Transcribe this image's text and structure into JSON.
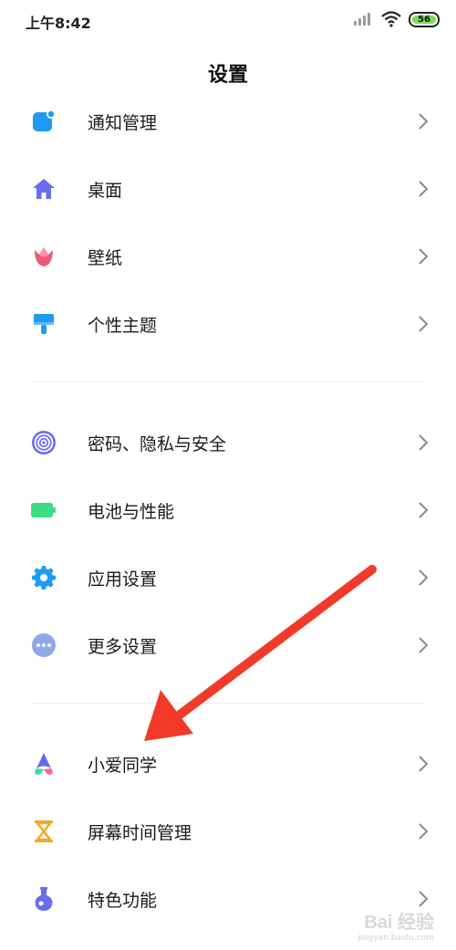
{
  "status_bar": {
    "time": "上午8:42",
    "battery": "56"
  },
  "header": {
    "title": "设置"
  },
  "sections": [
    {
      "items": [
        {
          "label": "通知管理",
          "icon": "notification-icon"
        },
        {
          "label": "桌面",
          "icon": "home-icon"
        },
        {
          "label": "壁纸",
          "icon": "tulip-icon"
        },
        {
          "label": "个性主题",
          "icon": "brush-icon"
        }
      ]
    },
    {
      "items": [
        {
          "label": "密码、隐私与安全",
          "icon": "fingerprint-icon"
        },
        {
          "label": "电池与性能",
          "icon": "battery-icon"
        },
        {
          "label": "应用设置",
          "icon": "gear-icon"
        },
        {
          "label": "更多设置",
          "icon": "more-icon"
        }
      ]
    },
    {
      "items": [
        {
          "label": "小爱同学",
          "icon": "xiaoai-icon"
        },
        {
          "label": "屏幕时间管理",
          "icon": "hourglass-icon"
        },
        {
          "label": "特色功能",
          "icon": "flask-icon"
        }
      ]
    }
  ],
  "watermark": {
    "main": "Bai 经验",
    "sub": "jingyan.baidu.com"
  },
  "colors": {
    "accent_blue": "#1e9bf0",
    "annotation_red": "#f23a2a",
    "divider": "#ececec"
  }
}
